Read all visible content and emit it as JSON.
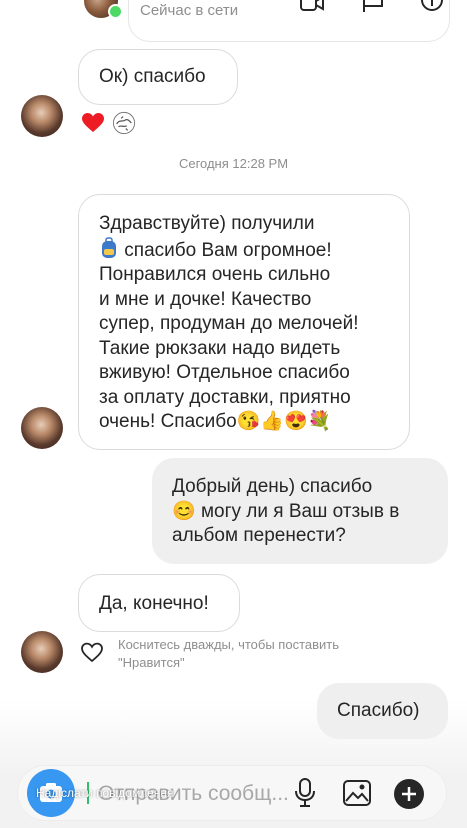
{
  "header": {
    "status": "Сейчас в сети"
  },
  "messages": {
    "m1": "Ок) спасибо",
    "timestamp": "Сегодня 12:28 PM",
    "m2_lines": [
      "Здравствуйте) получили",
      " спасибо Вам огромное!",
      "Понравился очень сильно",
      "и мне и дочке! Качество",
      "супер, продуман до мелочей!",
      "Такие рюкзаки надо видеть",
      "вживую!  Отдельное спасибо",
      "за оплату доставки, приятно",
      "очень! Спасибо"
    ],
    "m3_lines": [
      "Добрый день) спасибо",
      " могу ли я Ваш отзыв в",
      "альбом перенести?"
    ],
    "m4": "Да, конечно!",
    "hint_line1": "Коснитесь дважды, чтобы поставить",
    "hint_line2": "\"Нравится\"",
    "m5": "Спасибо)"
  },
  "composer": {
    "placeholder": "Отправить сообщ...",
    "watermark": "Надіслати повідомлення"
  },
  "icons": {
    "reaction_heart": "heart-icon",
    "reaction_sticker": "sticker-icon",
    "accent": "#3897f0"
  }
}
